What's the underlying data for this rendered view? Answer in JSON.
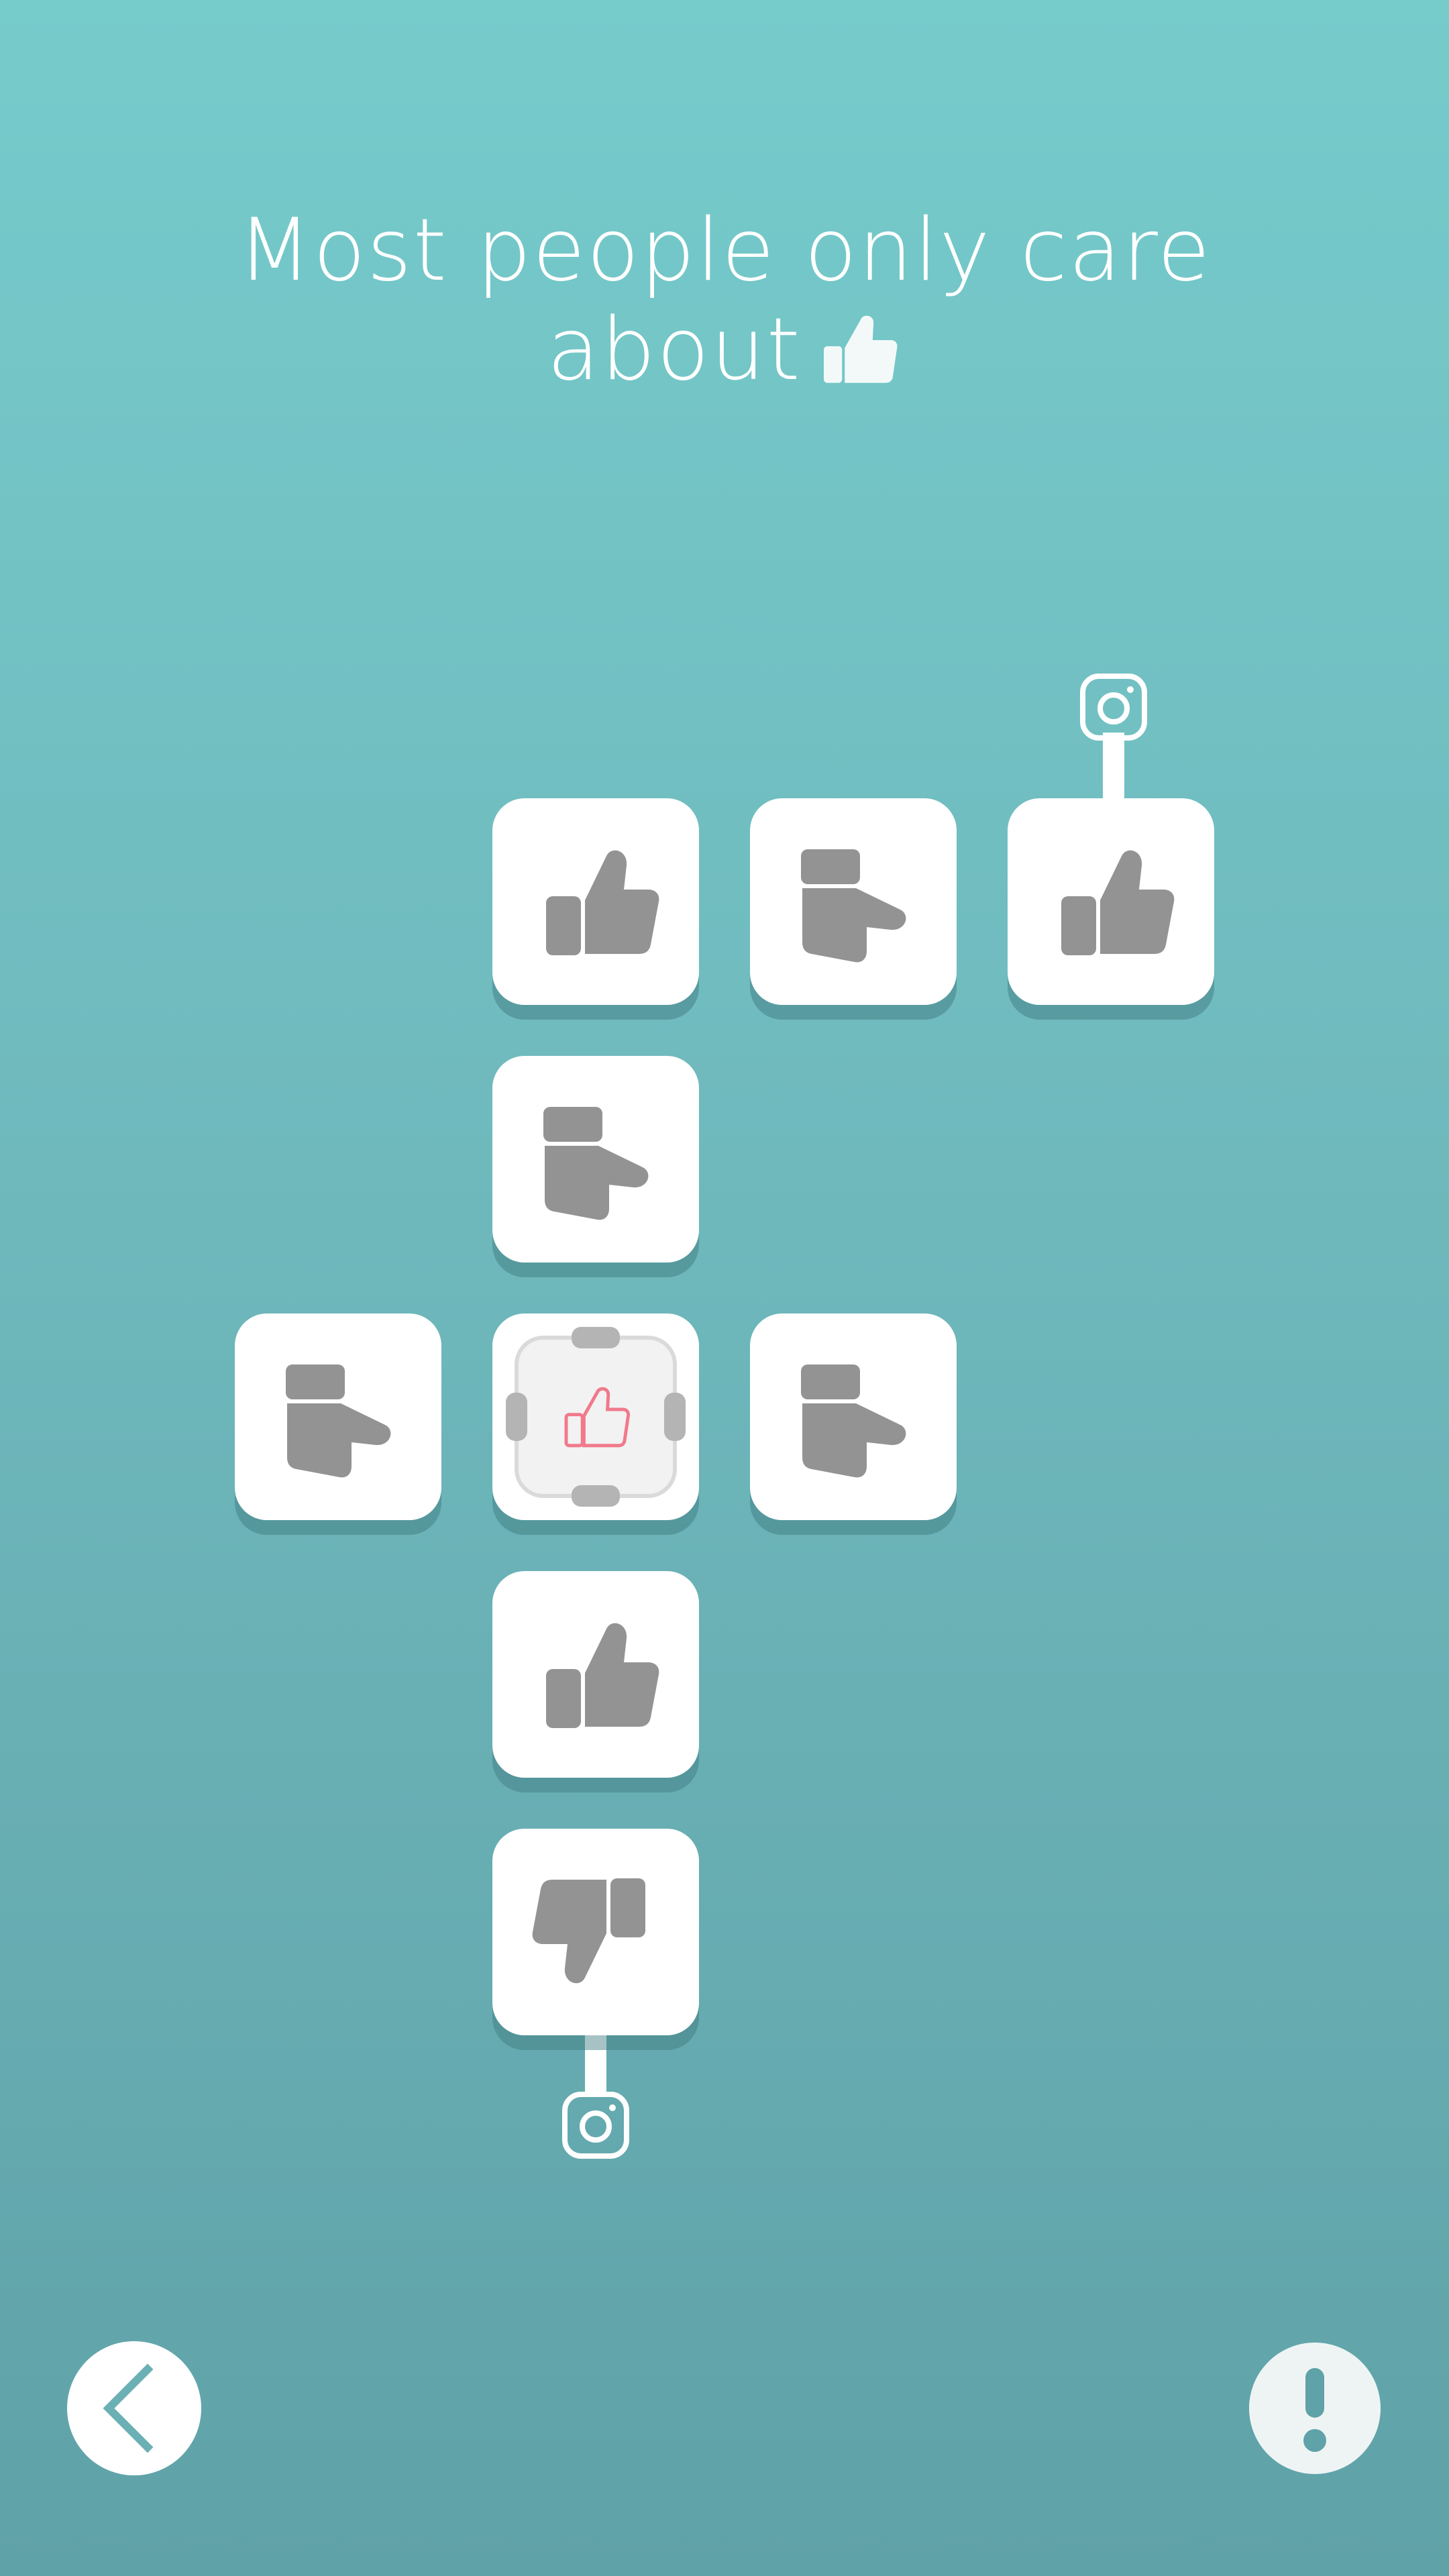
{
  "title": {
    "line1": "Most people only care",
    "line2": "about"
  },
  "icons": {
    "title_icon": "thumbs-up-icon",
    "goal_icon": "instagram-icon",
    "back_icon": "chevron-left-icon",
    "hint_icon": "exclamation-icon",
    "active_tile_icon": "thumbs-up-outline-icon"
  },
  "board": {
    "tiles": [
      {
        "id": "r1c2",
        "icon": "thumbs-up",
        "rotation_deg": 0
      },
      {
        "id": "r1c3",
        "icon": "thumbs-up",
        "rotation_deg": 90
      },
      {
        "id": "r1c4",
        "icon": "thumbs-up",
        "rotation_deg": 0
      },
      {
        "id": "r2c2",
        "icon": "thumbs-up",
        "rotation_deg": 90
      },
      {
        "id": "r3c1",
        "icon": "thumbs-up",
        "rotation_deg": 90
      },
      {
        "id": "r3c2",
        "icon": "thumbs-up-outline",
        "active": true
      },
      {
        "id": "r3c3",
        "icon": "thumbs-up",
        "rotation_deg": 90
      },
      {
        "id": "r4c2",
        "icon": "thumbs-up",
        "rotation_deg": 0
      },
      {
        "id": "r5c2",
        "icon": "thumbs-down",
        "rotation_deg": 180
      }
    ]
  },
  "colors": {
    "background_top": "#76cbcb",
    "background_bottom": "#5fa2a8",
    "tile": "#ffffff",
    "icon_gray": "#939393",
    "active_icon": "#f07a8c",
    "hint_fg": "#5fa2a8"
  }
}
